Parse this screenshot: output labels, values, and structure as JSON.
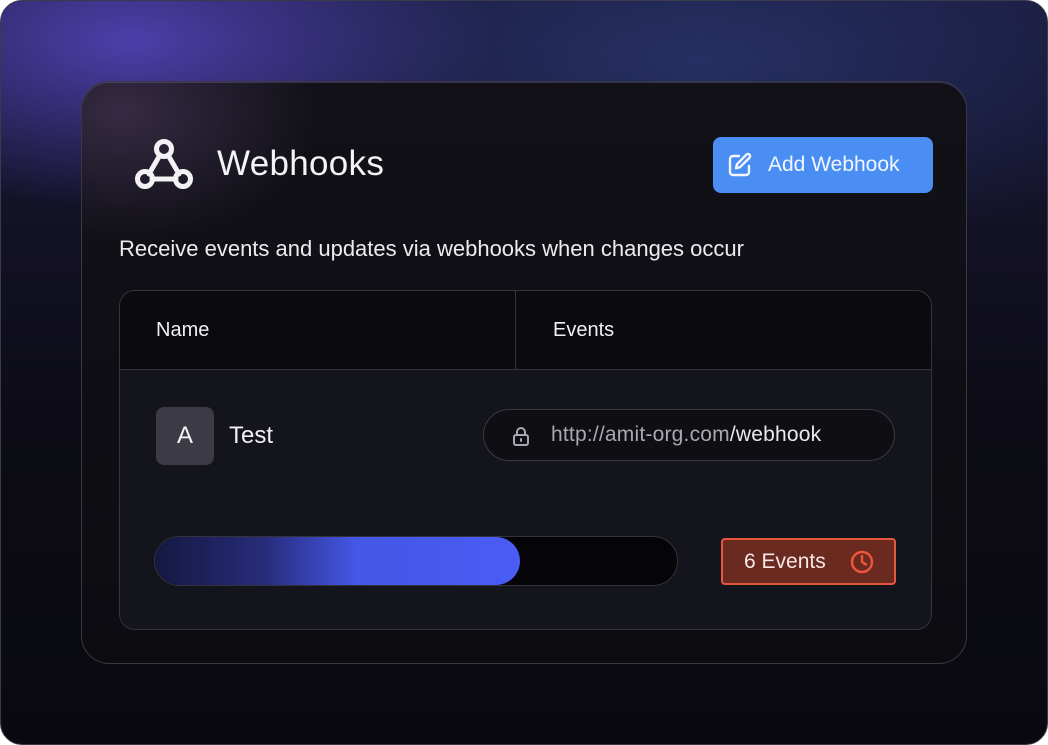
{
  "header": {
    "title": "Webhooks",
    "icon": "webhook-icon",
    "add_button_label": "Add Webhook",
    "add_button_icon": "edit-icon"
  },
  "subtitle": "Receive events and updates via webhooks when changes occur",
  "table": {
    "columns": [
      "Name",
      "Events"
    ],
    "rows": [
      {
        "avatar_initial": "A",
        "name": "Test",
        "url_host": "http://amit-org.com",
        "url_path": "/webhook",
        "url_icon": "lock-icon",
        "progress_percent": 70,
        "events_label": "6 Events",
        "events_icon": "clock-icon"
      }
    ]
  },
  "colors": {
    "accent_button": "#4a8ef4",
    "progress_fill": "#4a5cf4",
    "badge_border": "#e4573c",
    "badge_bg": "#6b2a20"
  }
}
